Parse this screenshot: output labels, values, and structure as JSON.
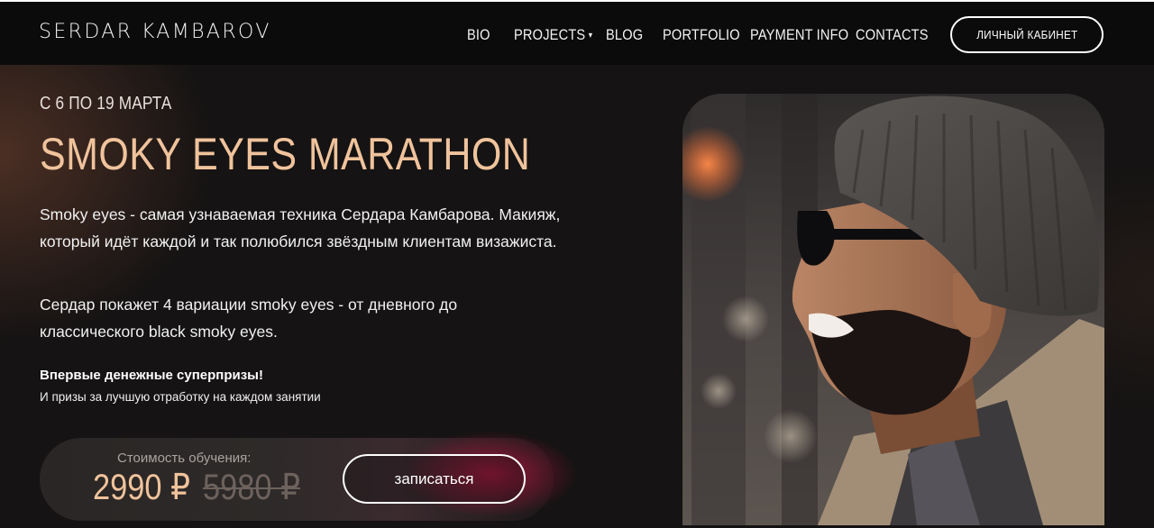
{
  "header": {
    "logo": "SERDAR KAMBAROV",
    "nav": [
      {
        "id": "bio",
        "label": "BIO",
        "has_dropdown": false
      },
      {
        "id": "projects",
        "label": "PROJECTS",
        "has_dropdown": true
      },
      {
        "id": "blog",
        "label": "BLOG",
        "has_dropdown": false
      },
      {
        "id": "portfolio",
        "label": "PORTFOLIO",
        "has_dropdown": false
      },
      {
        "id": "payment-info",
        "label": "PAYMENT INFO",
        "has_dropdown": false
      },
      {
        "id": "contacts",
        "label": "CONTACTS",
        "has_dropdown": false
      }
    ],
    "cabinet_label": "ЛИЧНЫЙ КАБИНЕТ",
    "dropdown_caret": "▾"
  },
  "hero": {
    "date": "С 6 ПО 19 МАРТА",
    "title": "SMOKY EYES MARATHON",
    "paragraph1": "Smoky eyes - самая узнаваемая техника Сердара Камбарова. Макияж, который идёт каждой и так полюбился звёздным клиентам визажиста.",
    "paragraph2": "Сердар покажет 4 вариации smoky eyes - от дневного до классического black smoky eyes.",
    "bonus_title": "Впервые денежные суперпризы!",
    "bonus_text": "И призы за лучшую отработку на каждом занятии"
  },
  "pricing": {
    "caption": "Стоимость обучения:",
    "price": "2990 ₽",
    "old_price": "5980 ₽",
    "signup_label": "записаться"
  },
  "colors": {
    "accent": "#f0c39c",
    "background": "#151313",
    "topbar": "#0c0b0b",
    "glow": "#c81446"
  }
}
